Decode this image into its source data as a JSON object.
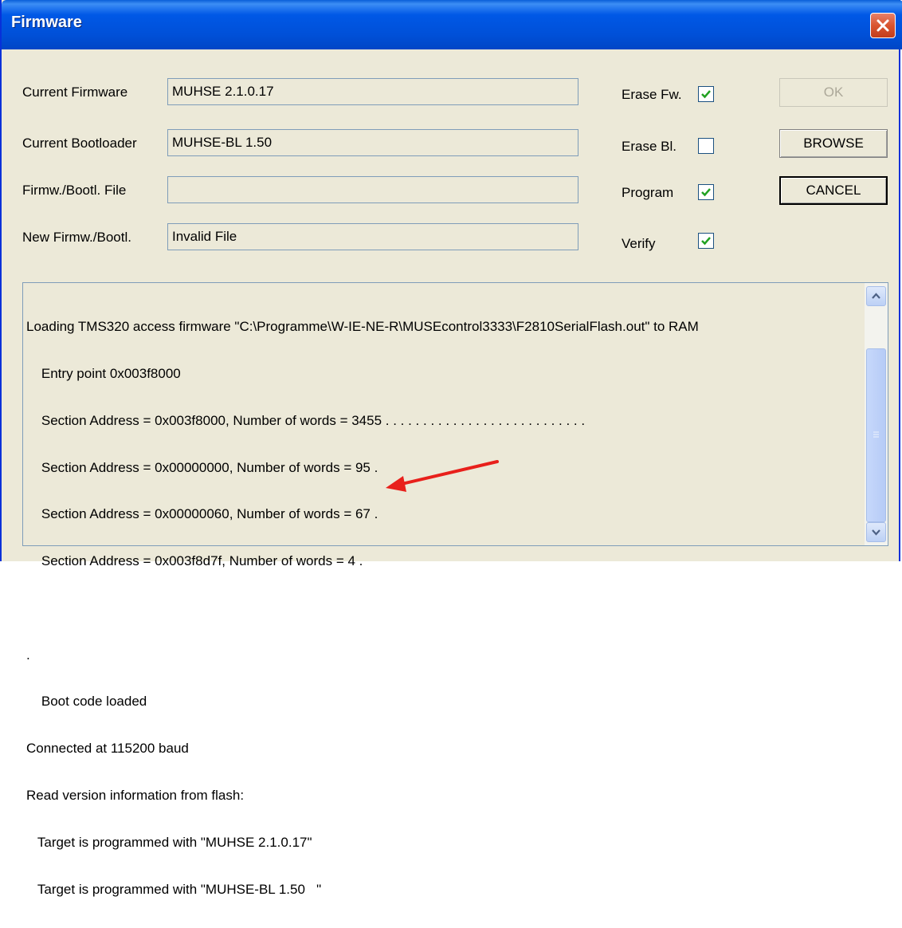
{
  "window": {
    "title": "Firmware"
  },
  "fields": [
    {
      "label": "Current Firmware",
      "value": "MUHSE 2.1.0.17"
    },
    {
      "label": "Current Bootloader",
      "value": "MUHSE-BL 1.50"
    },
    {
      "label": "Firmw./Bootl. File",
      "value": ""
    },
    {
      "label": "New Firmw./Bootl.",
      "value": "Invalid File"
    }
  ],
  "options": [
    {
      "label": "Erase Fw.",
      "checked": true
    },
    {
      "label": "Erase Bl.",
      "checked": false
    },
    {
      "label": "Program",
      "checked": true
    },
    {
      "label": "Verify",
      "checked": true
    }
  ],
  "buttons": {
    "ok": "OK",
    "browse": "BROWSE",
    "cancel": "CANCEL"
  },
  "log": [
    "Loading TMS320 access firmware \"C:\\Programme\\W-IE-NE-R\\MUSEcontrol3333\\F2810SerialFlash.out\" to RAM",
    "    Entry point 0x003f8000",
    "    Section Address = 0x003f8000, Number of words = 3455 . . . . . . . . . . . . . . . . . . . . . . . . . . .",
    "    Section Address = 0x00000000, Number of words = 95 .",
    "    Section Address = 0x00000060, Number of words = 67 .",
    "    Section Address = 0x003f8d7f, Number of words = 4 .",
    "",
    ".",
    "    Boot code loaded",
    "Connected at 115200 baud",
    "Read version information from flash:",
    "   Target is programmed with \"MUHSE 2.1.0.17\"",
    "   Target is programmed with \"MUHSE-BL 1.50   \""
  ],
  "colors": {
    "titlebar": "#0058e6",
    "dialog_bg": "#ece9d8",
    "annotation_arrow": "#e8201b"
  }
}
